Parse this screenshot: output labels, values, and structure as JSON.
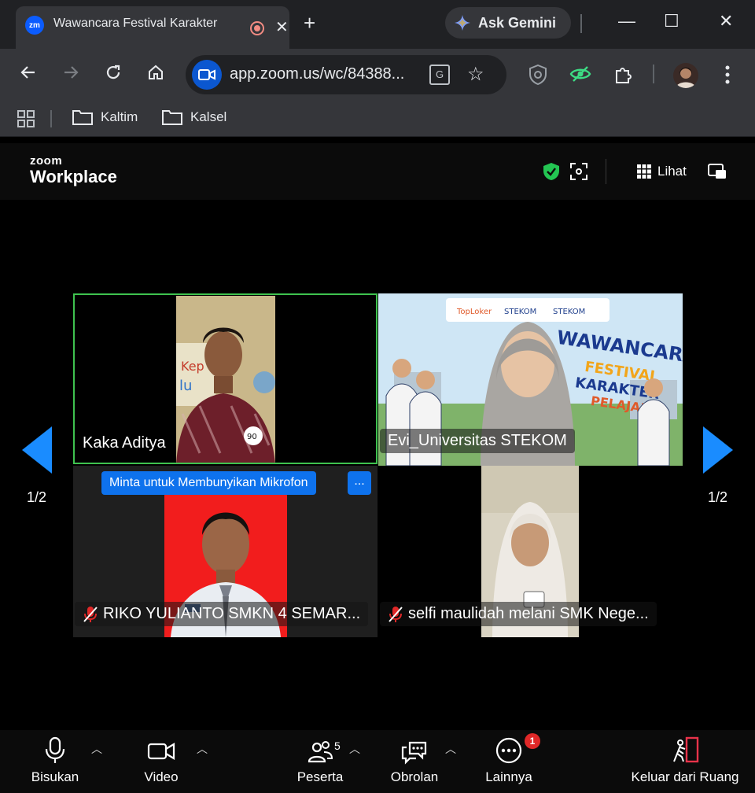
{
  "browser": {
    "tab": {
      "favicon_text": "zm",
      "title": "Wawancara Festival Karakter",
      "close": "✕"
    },
    "new_tab": "+",
    "gemini_label": "Ask Gemini",
    "window_controls": {
      "minimize": "—",
      "maximize": "☐",
      "close": "✕"
    },
    "url": "app.zoom.us/wc/84388...",
    "bookmarks": [
      "Kaltim",
      "Kalsel"
    ]
  },
  "zoom": {
    "logo_small": "zoom",
    "logo_big": "Workplace",
    "view_label": "Lihat",
    "page_left": "1/2",
    "page_right": "1/2",
    "participants": [
      {
        "name": "Kaka Aditya",
        "muted": false,
        "active_speaker": true
      },
      {
        "name": "Evi_Universitas STEKOM",
        "muted": false,
        "active_speaker": false
      },
      {
        "name": "RIKO YULIANTO SMKN 4 SEMAR...",
        "muted": true,
        "active_speaker": false
      },
      {
        "name": "selfi maulidah melani SMK Nege...",
        "muted": true,
        "active_speaker": false
      }
    ],
    "unmute_request_label": "Minta untuk Membunyikan Mikrofon",
    "unmute_more_label": "...",
    "footer": {
      "mute": "Bisukan",
      "video": "Video",
      "participants": "Peserta",
      "participants_count": "5",
      "chat": "Obrolan",
      "more": "Lainnya",
      "more_badge": "1",
      "leave": "Keluar dari Ruang"
    }
  },
  "colors": {
    "accent": "#0e72ed",
    "arrow": "#1a8cff",
    "active_speaker_border": "#3fc24f",
    "muted_icon": "#e02828"
  }
}
